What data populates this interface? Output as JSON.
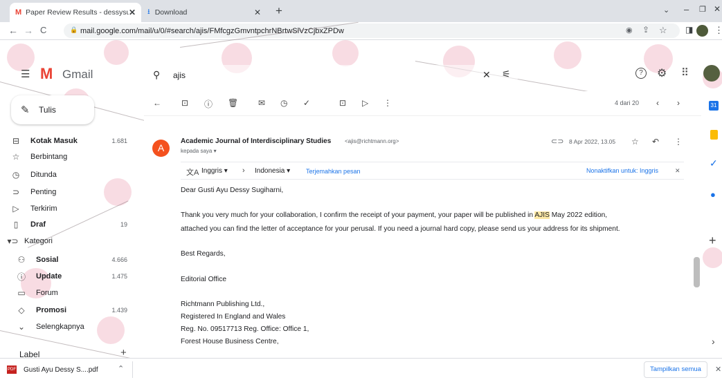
{
  "browser": {
    "tabs": [
      {
        "title": "Paper Review Results - dessysugi"
      },
      {
        "title": "Download"
      }
    ],
    "new_tab": "+",
    "url": "mail.google.com/mail/u/0/#search/ajis/FMfcgzGmvntpchrNBrtwSlVzCjbxZPDw"
  },
  "gmail": {
    "logo": "Gmail",
    "search_value": "ajis",
    "compose_label": "Tulis",
    "nav": [
      {
        "label": "Kotak Masuk",
        "count": "1.681",
        "icon": "inbox-icon",
        "bold": true
      },
      {
        "label": "Berbintang",
        "count": "",
        "icon": "star-icon"
      },
      {
        "label": "Ditunda",
        "count": "",
        "icon": "clock-icon"
      },
      {
        "label": "Penting",
        "count": "",
        "icon": "important-icon"
      },
      {
        "label": "Terkirim",
        "count": "",
        "icon": "send-icon"
      },
      {
        "label": "Draf",
        "count": "19",
        "icon": "draft-icon",
        "bold": true
      },
      {
        "label": "Kategori",
        "count": "",
        "icon": "label-icon"
      },
      {
        "label": "Sosial",
        "count": "4.666",
        "icon": "people-icon",
        "bold": true
      },
      {
        "label": "Update",
        "count": "1.475",
        "icon": "info-icon",
        "bold": true
      },
      {
        "label": "Forum",
        "count": "",
        "icon": "forum-icon"
      },
      {
        "label": "Promosi",
        "count": "1.439",
        "icon": "tag-icon",
        "bold": true
      },
      {
        "label": "Selengkapnya",
        "count": "",
        "icon": "chevron-down-icon"
      }
    ],
    "label_header": "Label",
    "pager": "4 dari 20",
    "email": {
      "avatar_letter": "A",
      "sender": "Academic Journal of Interdisciplinary Studies",
      "sender_email": "<ajis@richtmann.org>",
      "to": "kepada saya",
      "date": "8 Apr 2022, 13.05",
      "translate_from": "Inggris",
      "translate_to": "Indonesia",
      "translate_link": "Terjemahkan pesan",
      "translate_off": "Nonaktifkan untuk: Inggris",
      "greeting": "Dear Gusti Ayu Dessy Sugiharni,",
      "para1_a": "Thank you very much for your collaboration, I confirm the receipt of your payment, your paper will be published in ",
      "para1_hl": "AJIS",
      "para1_b": " May 2022 edition,",
      "para2": "attached you can find the letter of acceptance for your perusal. If you need a journal hard copy, please send us your address for its shipment.",
      "regards": "Best Regards,",
      "office": "Editorial Office",
      "addr1": "Richtmann Publishing Ltd.,",
      "addr2": "Registered In England and Wales",
      "addr3": "Reg. No. 09517713  Reg. Office: Office 1,",
      "addr4": "Forest House Business Centre,"
    }
  },
  "download": {
    "file": "Gusti Ayu Dessy S....pdf",
    "show_all": "Tampilkan semua"
  },
  "colors": {
    "gmail_red": "#ea4335",
    "avatar": "#f4511e",
    "link": "#1a73e8"
  }
}
